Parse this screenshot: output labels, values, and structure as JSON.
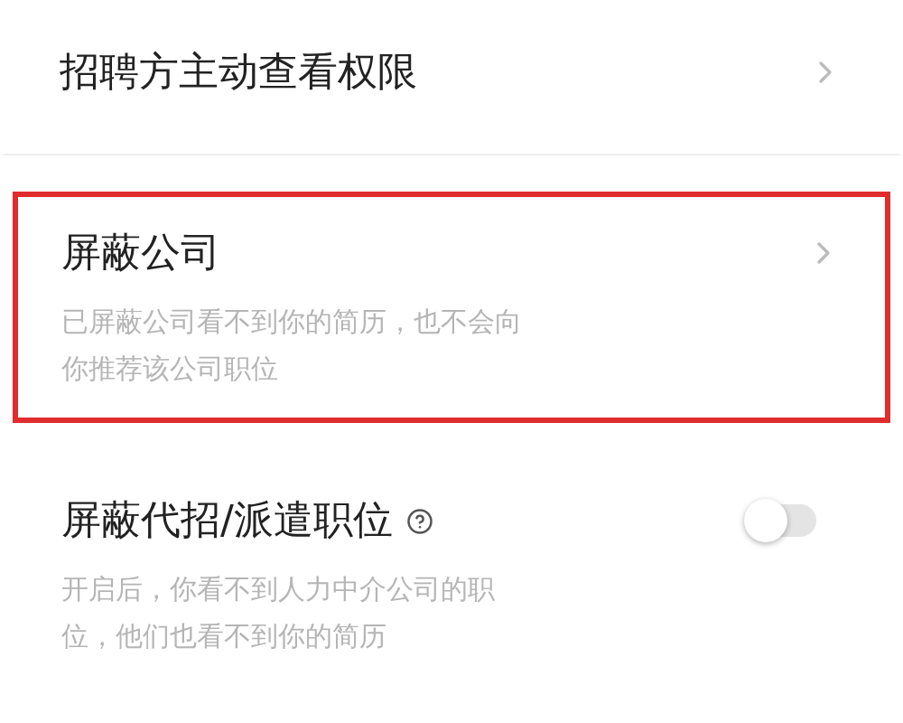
{
  "settings": [
    {
      "kind": "link",
      "title": "招聘方主动查看权限",
      "highlighted": false
    },
    {
      "kind": "link",
      "title": "屏蔽公司",
      "description": [
        "已屏蔽公司看不到你的简历，也不会向",
        "你推荐该公司职位"
      ],
      "highlighted": true
    },
    {
      "kind": "toggle",
      "title": "屏蔽代招/派遣职位",
      "help": true,
      "on": false,
      "description": [
        "开启后，你看不到人力中介公司的职",
        "位，他们也看不到你的简历"
      ],
      "highlighted": false
    }
  ]
}
